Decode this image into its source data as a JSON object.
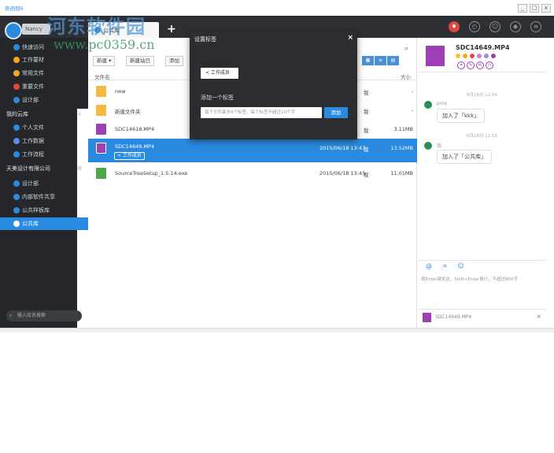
{
  "watermark": {
    "line1": "河东软件园",
    "line2": "www.pc0359.cn",
    "corner": "奇迹团队"
  },
  "topbar": {
    "username": "Nancy",
    "tab_label": "公共库",
    "add_tab": "+"
  },
  "window_controls": {
    "minimize": "_",
    "maximize": "□",
    "close": "x"
  },
  "sidebar": {
    "items_top": [
      {
        "label": "快速访问",
        "color": "#2a8ae0"
      },
      {
        "label": "工作要材",
        "color": "#f5a623"
      },
      {
        "label": "常用文件",
        "color": "#f5a623"
      },
      {
        "label": "重要文件",
        "color": "#e2473e"
      },
      {
        "label": "设计部",
        "color": "#2a8ae0"
      }
    ],
    "my_library": "我的云库",
    "my_library_add": "+",
    "items_my": [
      {
        "label": "个人文件",
        "color": "#2a8ae0"
      },
      {
        "label": "工作数据",
        "color": "#2a8ae0"
      },
      {
        "label": "工作流程",
        "color": "#2a8ae0"
      }
    ],
    "company": "天美设计有限公司",
    "company_gear": "⚙",
    "items_company": [
      {
        "label": "设计部",
        "color": "#2a8ae0"
      },
      {
        "label": "内部软件共享",
        "color": "#2a8ae0"
      },
      {
        "label": "公共样板库",
        "color": "#2a8ae0"
      },
      {
        "label": "公共库",
        "color": "#ffffff"
      }
    ],
    "search_placeholder": "输入库名搜索"
  },
  "toolbar": {
    "new_label": "新建 ▾",
    "new_folder_label": "新建站已",
    "upload_label": "添加"
  },
  "table": {
    "col_name": "文件名",
    "col_size": "大小",
    "rows": [
      {
        "name": "new",
        "date": "",
        "tag": "我",
        "size": "-",
        "type": "folder"
      },
      {
        "name": "新建文件夹",
        "date": "",
        "tag": "我",
        "size": "-",
        "type": "folder"
      },
      {
        "name": "SDC14618.MP4",
        "date": "",
        "tag": "我",
        "size": "3.11MB",
        "type": "video"
      },
      {
        "name": "SDC14649.MP4",
        "date": "2015/06/18 13:47",
        "tag": "我",
        "size": "13.52MB",
        "type": "video",
        "selected": true,
        "chip": "< 工作成员"
      },
      {
        "name": "SourceTreeSetup_1.5.14.exe",
        "date": "2015/06/18 13:45",
        "tag": "我",
        "size": "11.01MB",
        "type": "exe"
      }
    ]
  },
  "modal": {
    "title": "设置标签",
    "close": "×",
    "existing_tag": "< 工作成员",
    "add_label": "添加一个标签",
    "input_placeholder": "每个文件最多9个标签，每个标签不超过10个字",
    "add_button": "添加"
  },
  "right_panel": {
    "file_title": "SDC14649.MP4",
    "dot_colors": [
      "#f5c518",
      "#f5a623",
      "#e2473e",
      "#c77dd6",
      "#a08bd6",
      "#9d3fb5"
    ],
    "feed": [
      {
        "time": "6月18日 11:54",
        "user": "prox",
        "message": "加入了「kkk」"
      },
      {
        "time": "6月18日 11:55",
        "user": "我",
        "message": "加入了「公共库」"
      }
    ],
    "input_hint": "按Enter键发送，Shift+Enter换行，不超过800字",
    "footer_file": "SDC14649.MP4",
    "footer_close": "×"
  }
}
